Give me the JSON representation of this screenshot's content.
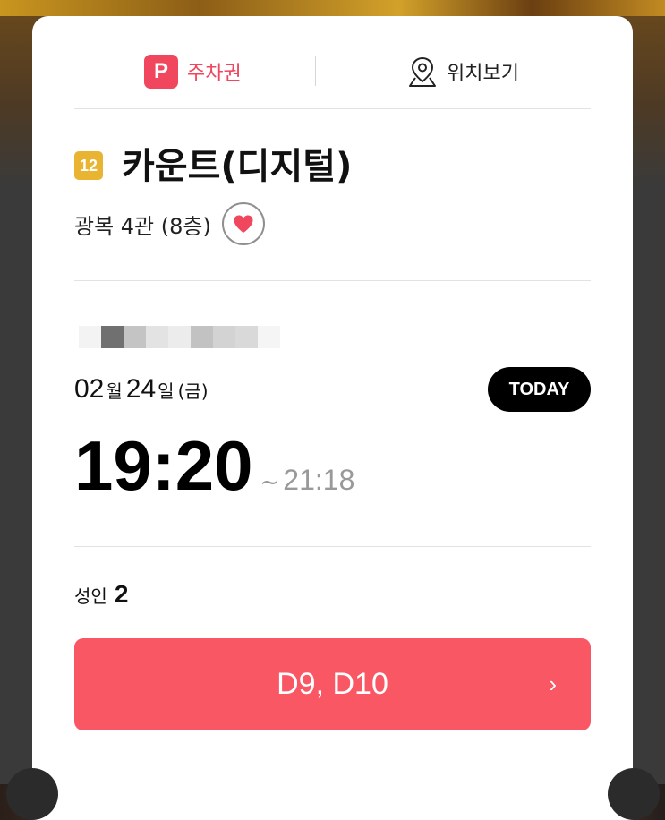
{
  "tabs": {
    "parking": {
      "icon_letter": "P",
      "label": "주차권",
      "color": "#f0465e"
    },
    "location": {
      "label": "위치보기"
    }
  },
  "movie": {
    "age_rating": "12",
    "age_rating_color": "#e9b431",
    "title": "카운트(디지털)",
    "theater": "광복 4관 (8층)",
    "favorite_icon": "heart-icon",
    "favorite_color": "#f0465e"
  },
  "schedule": {
    "month": "02",
    "month_unit": "월",
    "day": "24",
    "day_unit": "일",
    "weekday": "(금)",
    "today_badge": "TODAY",
    "start_time": "19:20",
    "separator": "~",
    "end_time": "21:18"
  },
  "tickets": {
    "type_label": "성인",
    "count": "2"
  },
  "seat_button": {
    "seats": "D9, D10",
    "chevron": "›",
    "color": "#fa5765"
  }
}
